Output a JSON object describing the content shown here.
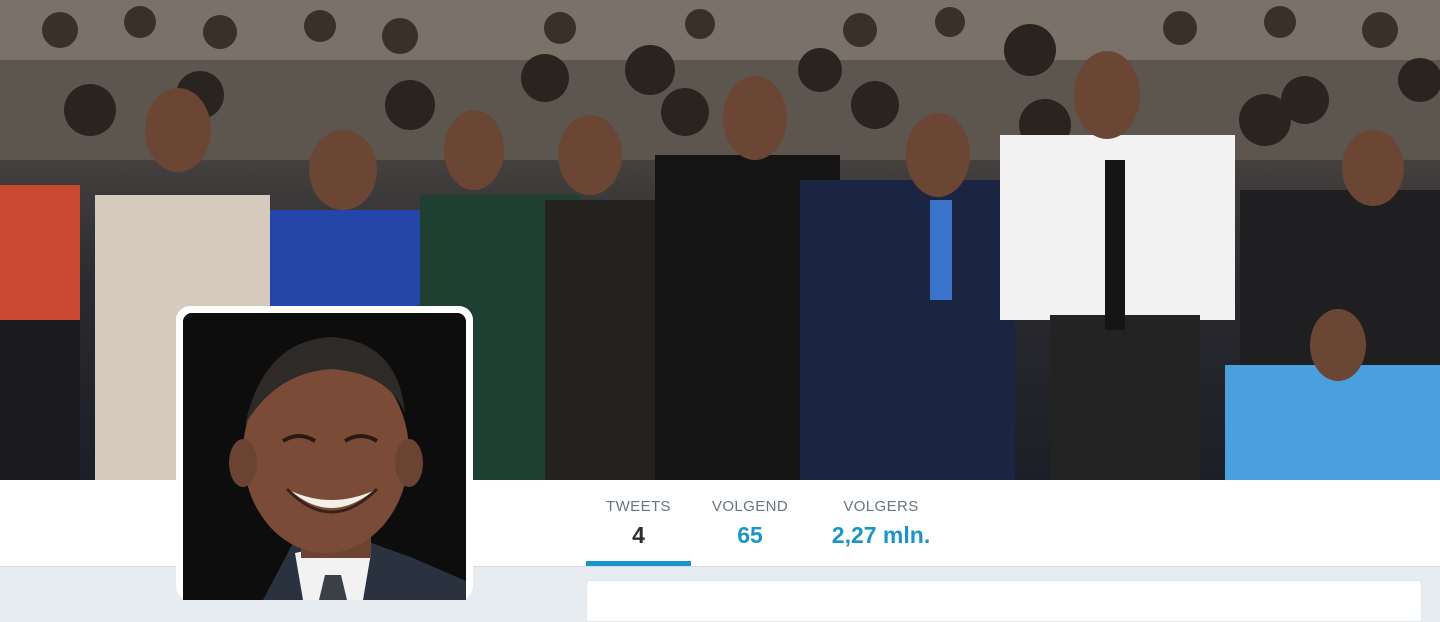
{
  "header": {
    "banner_description_icon": "crowd-photo",
    "colors": {
      "accent": "#1b95c9",
      "active_value": "#292f33",
      "label": "#66757f"
    }
  },
  "profile": {
    "avatar_icon": "profile-photo"
  },
  "stats": [
    {
      "label": "TWEETS",
      "value": "4",
      "active": true
    },
    {
      "label": "VOLGEND",
      "value": "65",
      "active": false
    },
    {
      "label": "VOLGERS",
      "value": "2,27 mln.",
      "active": false
    }
  ]
}
